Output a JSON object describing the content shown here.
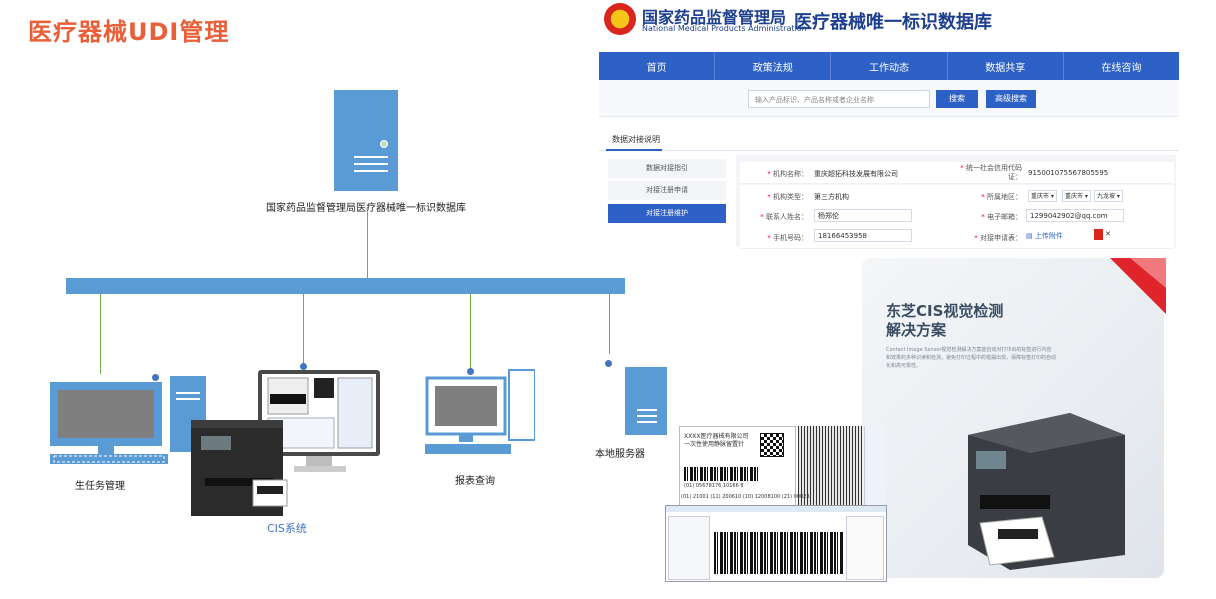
{
  "title": "医疗器械UDI管理",
  "diagram": {
    "top_server_label": "国家药品监督管理局医疗器械唯一标识数据库",
    "nodes": {
      "production": "生任务管理",
      "cis": "CIS系统",
      "report": "报表查询",
      "local_server": "本地服务器"
    }
  },
  "portal": {
    "org_cn": "国家药品监督管理局",
    "org_en": "National Medical Products Administration",
    "db_title": "医疗器械唯一标识数据库",
    "nav": [
      "首页",
      "政策法规",
      "工作动态",
      "数据共享",
      "在线咨询"
    ],
    "search": {
      "placeholder": "输入产品标识、产品名称或者企业名称",
      "search_btn": "搜索",
      "advanced_btn": "高级搜索"
    },
    "tab": "数据对接说明",
    "sidebar": [
      "数据对接指引",
      "对接注册申请",
      "对接注册维护"
    ],
    "form": {
      "org_name_label": "机构名称：",
      "org_name": "重庆超拓科技发展有限公司",
      "credit_code_label": "统一社会信用代码证：",
      "credit_code": "915001075567805595",
      "org_type_label": "机构类型：",
      "org_type": "第三方机构",
      "region_label": "所属地区：",
      "region": [
        "重庆市",
        "重庆市",
        "九龙坡"
      ],
      "contact_label": "联系人姓名：",
      "contact": "杨郑伦",
      "email_label": "电子邮箱：",
      "email": "1299042902@qq.com",
      "phone_label": "手机号码：",
      "phone": "18166453958",
      "application_label": "对接申请表：",
      "upload": "上传附件"
    }
  },
  "brochure": {
    "title_line1": "东芝CIS视觉检测",
    "title_line2": "解决方案",
    "desc": "Contact Image Sensor视觉检测解决方案能自动对打印出的标签进行内容和效果的多种识读和检测，避免打印过程中的错漏出现，保障标签打印的自动化和高可靠性。",
    "label_company": "XXXX医疗器械有限公司",
    "label_product": "一次性使用静脉留置针",
    "label_code": "(01) 05678176 10166 8",
    "label_code_full": "(01) 21001 (11) 200610 (10) 12008100 (21) 00023"
  },
  "colors": {
    "title": "#e8603a",
    "network_blue": "#5b9bd5",
    "link_green": "#70ad47",
    "portal_blue": "#2e61c6"
  }
}
